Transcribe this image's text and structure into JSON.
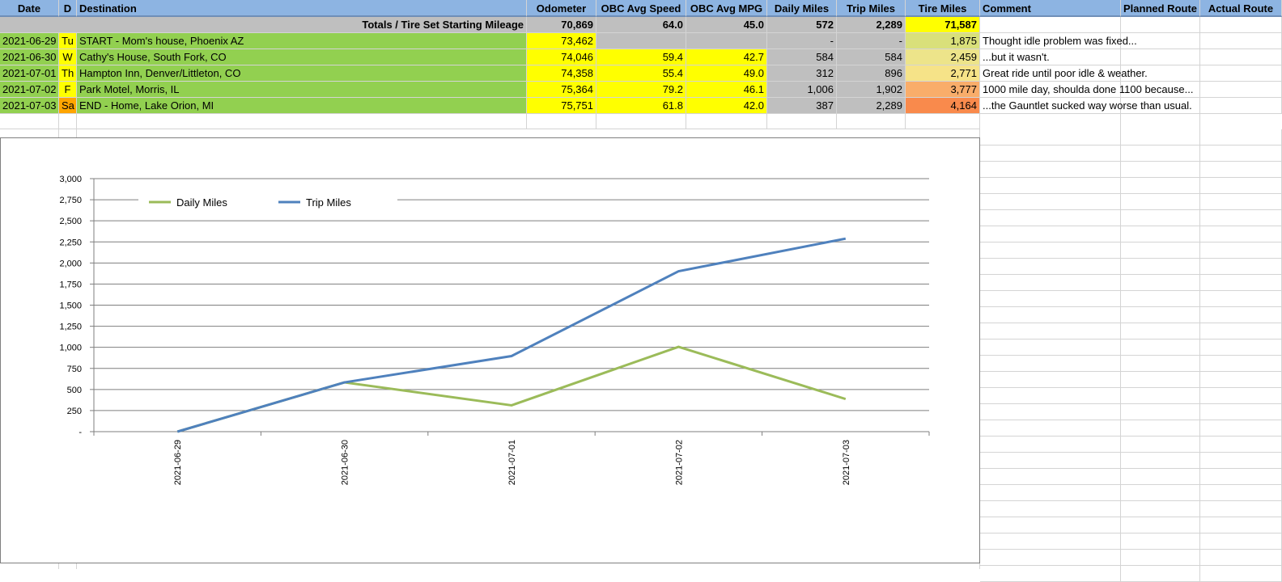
{
  "headers": {
    "date": "Date",
    "day": "D",
    "destination": "Destination",
    "odometer": "Odometer",
    "obc_speed": "OBC Avg Speed",
    "obc_mpg": "OBC Avg MPG",
    "daily_miles": "Daily Miles",
    "trip_miles": "Trip Miles",
    "tire_miles": "Tire Miles",
    "comment": "Comment",
    "planned_route": "Planned Route",
    "actual_route": "Actual Route"
  },
  "totals": {
    "label": "Totals / Tire Set Starting Mileage",
    "odometer": "70,869",
    "obc_speed": "64.0",
    "obc_mpg": "45.0",
    "daily_miles": "572",
    "trip_miles": "2,289",
    "tire_miles": "71,587"
  },
  "rows": [
    {
      "date": "2021-06-29",
      "day": "Tu",
      "destination": "START - Mom's house, Phoenix AZ",
      "odometer": "73,462",
      "obc_speed": "",
      "obc_mpg": "",
      "daily_miles": "-",
      "trip_miles": "-",
      "tire_miles": "1,875",
      "comment": "Thought idle problem was fixed...",
      "day_color": "#ffff00",
      "tire_color": "#d9e07a"
    },
    {
      "date": "2021-06-30",
      "day": "W",
      "destination": "Cathy's House, South Fork, CO",
      "odometer": "74,046",
      "obc_speed": "59.4",
      "obc_mpg": "42.7",
      "daily_miles": "584",
      "trip_miles": "584",
      "tire_miles": "2,459",
      "comment": "...but it wasn't.",
      "day_color": "#ffff00",
      "tire_color": "#ede48a"
    },
    {
      "date": "2021-07-01",
      "day": "Th",
      "destination": "Hampton Inn, Denver/Littleton, CO",
      "odometer": "74,358",
      "obc_speed": "55.4",
      "obc_mpg": "49.0",
      "daily_miles": "312",
      "trip_miles": "896",
      "tire_miles": "2,771",
      "comment": "Great ride until poor idle & weather.",
      "day_color": "#ffff00",
      "tire_color": "#f6e388"
    },
    {
      "date": "2021-07-02",
      "day": "F",
      "destination": "Park Motel, Morris, IL",
      "odometer": "75,364",
      "obc_speed": "79.2",
      "obc_mpg": "46.1",
      "daily_miles": "1,006",
      "trip_miles": "1,902",
      "tire_miles": "3,777",
      "comment": "1000 mile day, shoulda done 1100 because...",
      "day_color": "#ffff00",
      "tire_color": "#f9ad6a"
    },
    {
      "date": "2021-07-03",
      "day": "Sa",
      "destination": "END - Home, Lake Orion, MI",
      "odometer": "75,751",
      "obc_speed": "61.8",
      "obc_mpg": "42.0",
      "daily_miles": "387",
      "trip_miles": "2,289",
      "tire_miles": "4,164",
      "comment": "...the Gauntlet sucked way worse than usual.",
      "day_color": "#ffa500",
      "tire_color": "#f98a4c"
    }
  ],
  "colors": {
    "header_blue": "#8db4e2",
    "dest_green": "#92d050",
    "highlight_yellow": "#ffff00",
    "totals_gray": "#bfbfbf",
    "daily_line": "#9bbb59",
    "trip_line": "#4f81bd"
  },
  "chart_data": {
    "type": "line",
    "categories": [
      "2021-06-29",
      "2021-06-30",
      "2021-07-01",
      "2021-07-02",
      "2021-07-03"
    ],
    "series": [
      {
        "name": "Daily Miles",
        "values": [
          0,
          584,
          312,
          1006,
          387
        ],
        "color": "#9bbb59"
      },
      {
        "name": "Trip Miles",
        "values": [
          0,
          584,
          896,
          1902,
          2289
        ],
        "color": "#4f81bd"
      }
    ],
    "ylim": [
      0,
      3000
    ],
    "yticks": [
      "-",
      "250",
      "500",
      "750",
      "1,000",
      "1,250",
      "1,500",
      "1,750",
      "2,000",
      "2,250",
      "2,500",
      "2,750",
      "3,000"
    ],
    "grid": true,
    "legend_position": "top-left"
  }
}
